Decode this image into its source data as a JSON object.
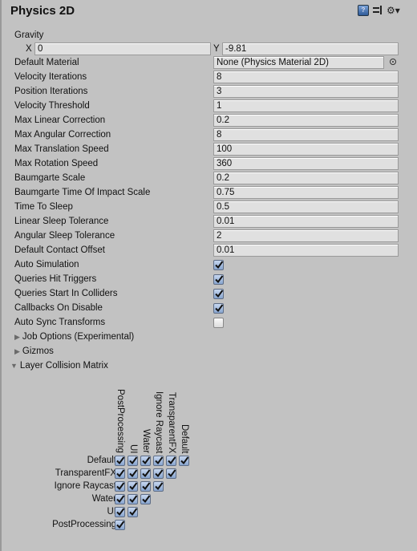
{
  "header": {
    "title": "Physics 2D",
    "icons": [
      "help-icon",
      "preset-icon",
      "gear-icon"
    ]
  },
  "gravity": {
    "label": "Gravity",
    "x_label": "X",
    "x_value": "0",
    "y_label": "Y",
    "y_value": "-9.81"
  },
  "default_material": {
    "label": "Default Material",
    "value": "None (Physics Material 2D)"
  },
  "numeric_fields": [
    {
      "label": "Velocity Iterations",
      "value": "8"
    },
    {
      "label": "Position Iterations",
      "value": "3"
    },
    {
      "label": "Velocity Threshold",
      "value": "1"
    },
    {
      "label": "Max Linear Correction",
      "value": "0.2"
    },
    {
      "label": "Max Angular Correction",
      "value": "8"
    },
    {
      "label": "Max Translation Speed",
      "value": "100"
    },
    {
      "label": "Max Rotation Speed",
      "value": "360"
    },
    {
      "label": "Baumgarte Scale",
      "value": "0.2"
    },
    {
      "label": "Baumgarte Time Of Impact Scale",
      "value": "0.75"
    },
    {
      "label": "Time To Sleep",
      "value": "0.5"
    },
    {
      "label": "Linear Sleep Tolerance",
      "value": "0.01"
    },
    {
      "label": "Angular Sleep Tolerance",
      "value": "2"
    },
    {
      "label": "Default Contact Offset",
      "value": "0.01"
    }
  ],
  "toggles": [
    {
      "label": "Auto Simulation",
      "checked": true
    },
    {
      "label": "Queries Hit Triggers",
      "checked": true
    },
    {
      "label": "Queries Start In Colliders",
      "checked": true
    },
    {
      "label": "Callbacks On Disable",
      "checked": true
    },
    {
      "label": "Auto Sync Transforms",
      "checked": false
    }
  ],
  "foldouts": [
    {
      "label": "Job Options (Experimental)",
      "expanded": false
    },
    {
      "label": "Gizmos",
      "expanded": false
    },
    {
      "label": "Layer Collision Matrix",
      "expanded": true
    }
  ],
  "collision_matrix": {
    "columns": [
      "PostProcessing",
      "UI",
      "Water",
      "Ignore Raycast",
      "TransparentFX",
      "Default"
    ],
    "rows": [
      {
        "label": "Default",
        "checks": [
          true,
          true,
          true,
          true,
          true,
          true
        ]
      },
      {
        "label": "TransparentFX",
        "checks": [
          true,
          true,
          true,
          true,
          true
        ]
      },
      {
        "label": "Ignore Raycast",
        "checks": [
          true,
          true,
          true,
          true
        ]
      },
      {
        "label": "Water",
        "checks": [
          true,
          true,
          true
        ]
      },
      {
        "label": "UI",
        "checks": [
          true,
          true
        ]
      },
      {
        "label": "PostProcessing",
        "checks": [
          true
        ]
      }
    ]
  }
}
